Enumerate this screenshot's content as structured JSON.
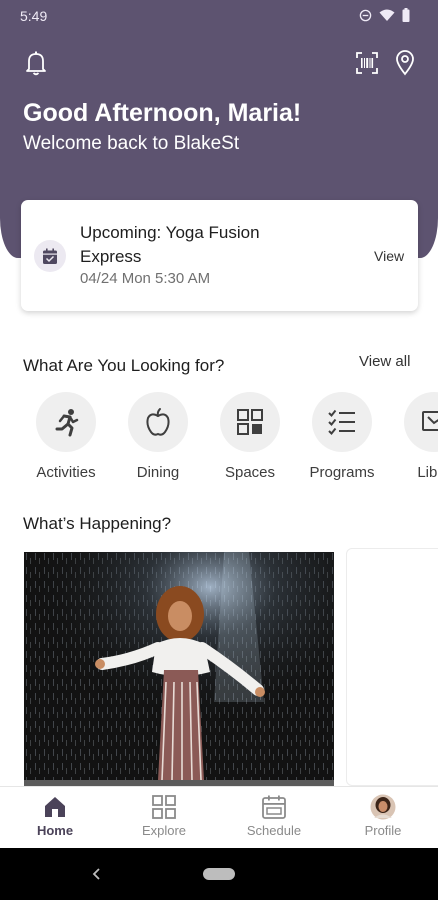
{
  "status_bar": {
    "time": "5:49"
  },
  "header": {
    "greeting": "Good Afternoon, Maria!",
    "subtitle": "Welcome back to BlakeSt",
    "color": "#5d5370"
  },
  "upcoming": {
    "title": "Upcoming: Yoga Fusion Express",
    "datetime": "04/24 Mon 5:30 AM",
    "action": "View"
  },
  "lookup": {
    "title": "What Are You Looking for?",
    "view_all": "View all",
    "categories": [
      {
        "label": "Activities",
        "icon": "running-person-icon"
      },
      {
        "label": "Dining",
        "icon": "apple-icon"
      },
      {
        "label": "Spaces",
        "icon": "grid-icon"
      },
      {
        "label": "Programs",
        "icon": "checklist-icon"
      },
      {
        "label": "Libra",
        "icon": "library-icon"
      }
    ]
  },
  "happening": {
    "title": "What’s Happening?"
  },
  "bottom_nav": [
    {
      "label": "Home",
      "icon": "home-icon",
      "active": true
    },
    {
      "label": "Explore",
      "icon": "explore-grid-icon",
      "active": false
    },
    {
      "label": "Schedule",
      "icon": "calendar-icon",
      "active": false
    },
    {
      "label": "Profile",
      "icon": "avatar",
      "active": false
    }
  ]
}
